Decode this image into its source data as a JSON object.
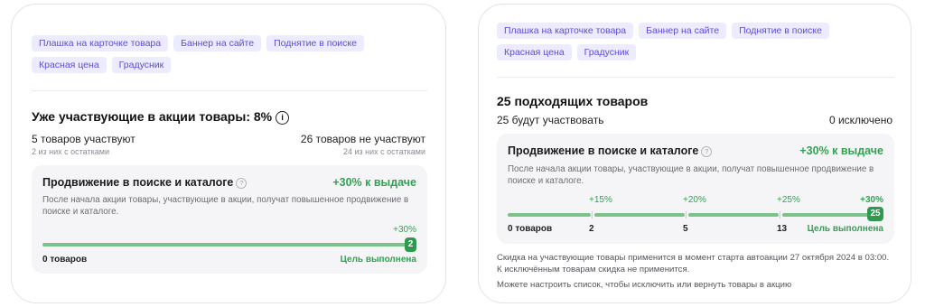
{
  "left": {
    "chips": [
      "Плашка на карточке товара",
      "Баннер на сайте",
      "Поднятие в поиске",
      "Красная цена",
      "Градусник"
    ],
    "title": "Уже участвующие в акции товары: 8%",
    "info_glyph": "i",
    "participating": "5 товаров участвуют",
    "participating_sub": "2 из них с остатками",
    "not_participating": "26 товаров не участвуют",
    "not_participating_sub": "24 из них с остатками",
    "panel": {
      "title": "Продвижение в поиске и каталоге",
      "help_glyph": "?",
      "boost": "+30% к выдаче",
      "description": "После начала акции товары, участвующие в акции, получат повышенное продвижение в поиске и каталоге.",
      "milestone_label": "+30%",
      "badge_value": "2",
      "start_label": "0 товаров",
      "goal_label": "Цель выполнена",
      "progress": 1.0
    }
  },
  "right": {
    "chips": [
      "Плашка на карточке товара",
      "Баннер на сайте",
      "Поднятие в поиске",
      "Красная цена",
      "Градусник"
    ],
    "title": "25 подходящих товаров",
    "will_participate": "25 будут участвовать",
    "excluded": "0 исключено",
    "panel": {
      "title": "Продвижение в поиске и каталоге",
      "help_glyph": "?",
      "boost": "+30% к выдаче",
      "description": "После начала акции товары, участвующие в акции, получат повышенное продвижение в поиске и каталоге.",
      "milestones": [
        "+15%",
        "+20%",
        "+25%",
        "+30%"
      ],
      "counts": [
        "0 товаров",
        "2",
        "5",
        "13"
      ],
      "badge_value": "25",
      "goal_label": "Цель выполнена"
    },
    "footnote": "Скидка на участвующие товары применится в момент старта автоакции 27 октября 2024 в 03:00. К исключённым товарам скидка не применится.",
    "footnote2": "Можете настроить список, чтобы исключить или вернуть товары в акцию"
  },
  "colors": {
    "chip_bg": "#ecebff",
    "chip_text": "#5b4fd1",
    "accent_green": "#33a153",
    "bar_green": "#7cc38b",
    "badge_green": "#2f9a4d"
  }
}
